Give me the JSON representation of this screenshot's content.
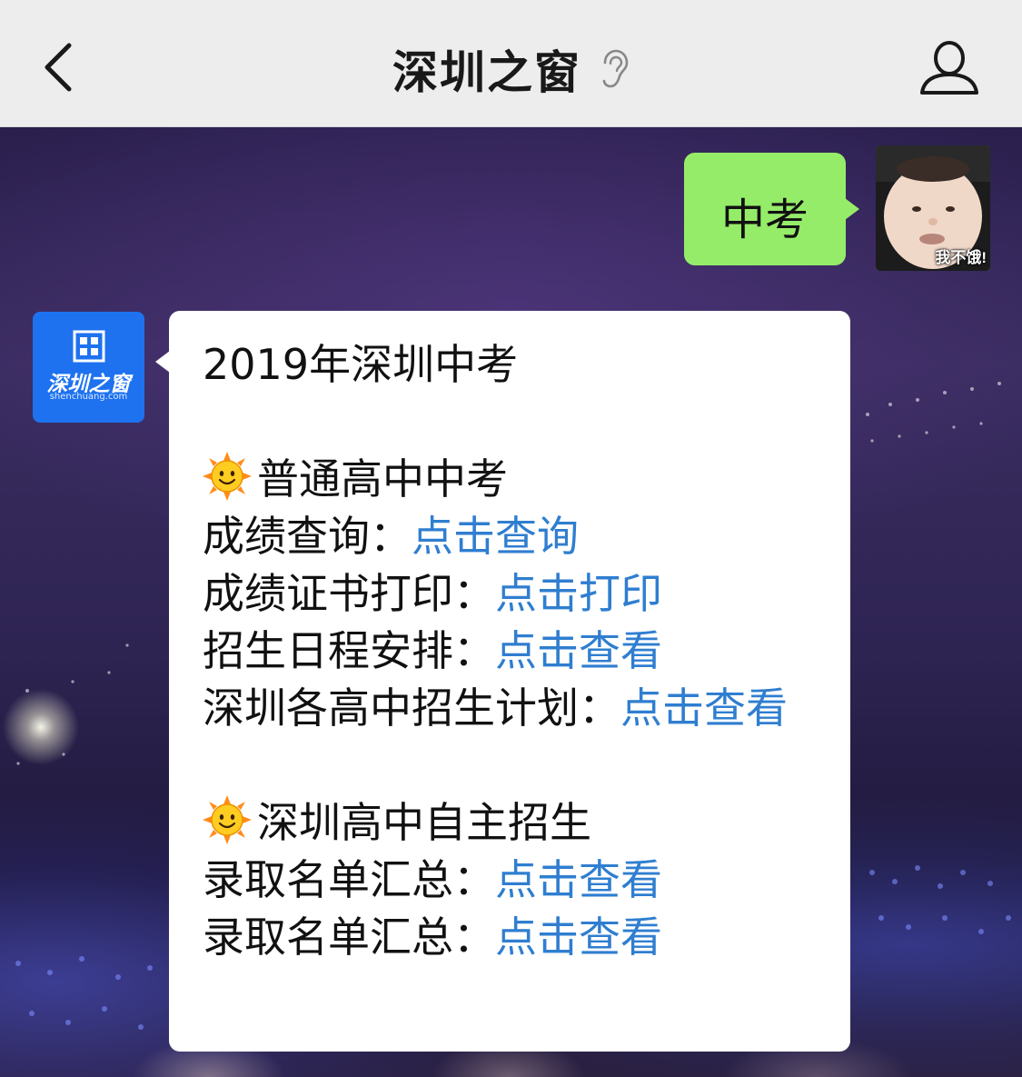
{
  "nav": {
    "title": "深圳之窗",
    "back_icon": "chevron-left-icon",
    "mode_icon": "ear-icon",
    "profile_icon": "person-icon"
  },
  "outgoing": {
    "text": "中考",
    "avatar_caption": "我不饿!",
    "bubble_color": "#95ec69"
  },
  "sender": {
    "logo_text": "深圳之窗",
    "logo_url": "shenchuang.com",
    "brand_color": "#1e72f0"
  },
  "incoming": {
    "title": "2019年深圳中考",
    "section1": {
      "heading": "普通高中中考",
      "items": [
        {
          "label": "成绩查询：",
          "link": "点击查询"
        },
        {
          "label": "成绩证书打印：",
          "link": "点击打印"
        },
        {
          "label": "招生日程安排：",
          "link": "点击查看"
        },
        {
          "label": "深圳各高中招生计划：",
          "link": "点击查看"
        }
      ]
    },
    "section2": {
      "heading": "深圳高中自主招生",
      "items": [
        {
          "label": "录取名单汇总：",
          "link": "点击查看"
        },
        {
          "label": "录取名单汇总：",
          "link": "点击查看"
        }
      ]
    },
    "link_color": "#2f7ed0"
  }
}
